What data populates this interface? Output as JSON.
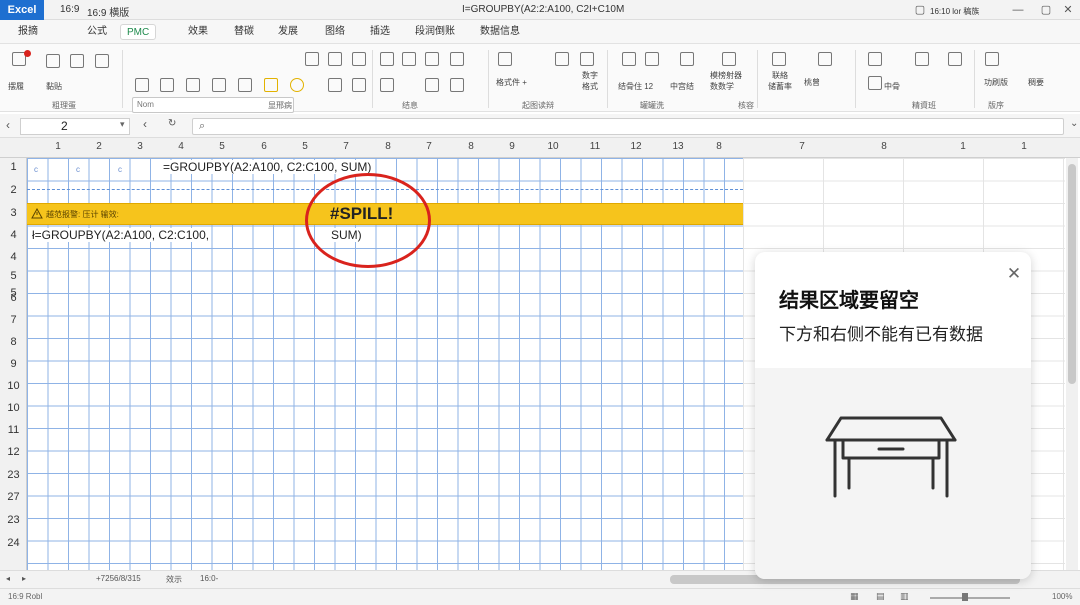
{
  "titlebar": {
    "app": "Excel",
    "items": [
      "16:9",
      "16:9 横版"
    ],
    "formula_title": "I=GROUPBY(A2:2:A100, C2I+C10M",
    "right_text": "16:10 lor 稿族"
  },
  "tabs": [
    "报摘",
    "公式",
    "PMC",
    "效果",
    "替碳",
    "发展",
    "图络",
    "插选",
    "段润倒账",
    "数据信息"
  ],
  "ribbon": {
    "font_placeholder": "Nom",
    "labels": [
      "摆履",
      "黏贴",
      "格式件 +",
      "数字",
      "格式",
      "结骨住 12",
      "中宫结",
      "模榜射器",
      "数数学",
      "联絡",
      "储蓄率",
      "桃曾",
      "中骨",
      "功刷版",
      "稠要"
    ],
    "groups": [
      "粗理蛋",
      "显邢病",
      "结息",
      "起图读辩",
      "罐罐洗",
      "核容",
      "精資班",
      "版序"
    ]
  },
  "formula_bar": {
    "name_box": "2",
    "formula": ""
  },
  "columns": [
    "1",
    "2",
    "3",
    "4",
    "5",
    "6",
    "5",
    "7",
    "8",
    "7",
    "8",
    "9",
    "10",
    "11",
    "12",
    "13",
    "8",
    "7",
    "8",
    "1",
    "1"
  ],
  "rows": [
    "1",
    "2",
    "3",
    "4",
    "4",
    "5",
    "6",
    "7",
    "8",
    "9",
    "10",
    "10",
    "11",
    "12",
    "23",
    "27",
    "23",
    "24",
    "25"
  ],
  "cells": {
    "row1_formula": "=GROUPBY(A2:A100, C2:C100, SUM)",
    "row1_marks": [
      "c",
      "c",
      "c"
    ],
    "row3_warning": "越范报警: 压计  输效:",
    "row4_formula": "ł=GROUPBY(A2:A100, C2:C100,",
    "row4_sum": "SUM)",
    "spill_error": "#SPILL!"
  },
  "sheet_tabs": [
    "+7256/8/315",
    "效示",
    "16:0-"
  ],
  "status": {
    "left": "16:9 Robl",
    "right": "100%"
  },
  "tip": {
    "title": "结果区域要留空",
    "body": "下方和右侧不能有已有数据",
    "illustration": "table-icon"
  },
  "colors": {
    "accent": "#1e6fd0",
    "warning_band": "#f6c41c",
    "error_circle": "#d9231d",
    "grid_line": "#8fb3e6"
  }
}
